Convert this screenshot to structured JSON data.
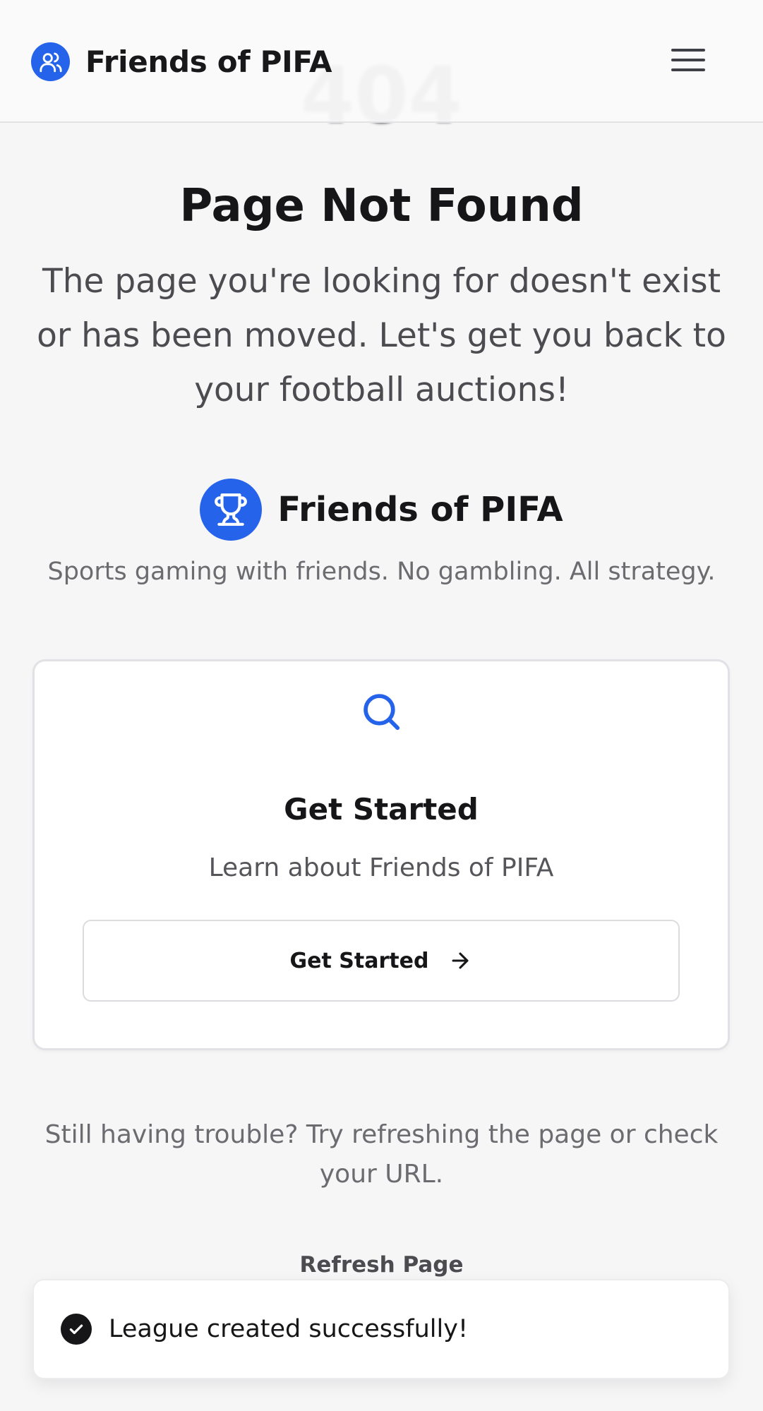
{
  "header": {
    "brand_name": "Friends of PIFA",
    "brand_icon": "users-icon",
    "menu_icon": "menu-icon"
  },
  "error": {
    "code": "404",
    "title": "Page Not Found",
    "description": "The page you're looking for doesn't exist or has been moved. Let's get you back to your football auctions!"
  },
  "brand_block": {
    "name": "Friends of PIFA",
    "icon": "trophy-icon",
    "tagline": "Sports gaming with friends. No gambling. All strategy."
  },
  "card": {
    "icon": "search-icon",
    "title": "Get Started",
    "subtitle": "Learn about Friends of PIFA",
    "button_label": "Get Started",
    "button_icon": "arrow-right-icon"
  },
  "help": {
    "text": "Still having trouble? Try refreshing the page or check your URL.",
    "refresh_label": "Refresh Page"
  },
  "toast": {
    "icon": "check-circle-icon",
    "message": "League created successfully!"
  },
  "colors": {
    "accent": "#2563eb",
    "background": "#f6f6f7",
    "text": "#161618"
  }
}
